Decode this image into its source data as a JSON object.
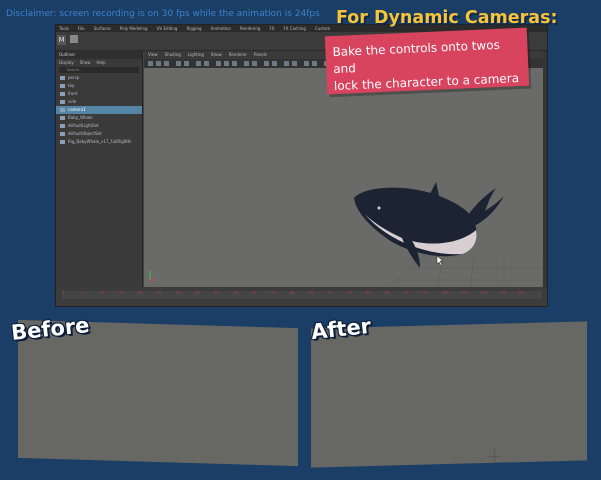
{
  "disclaimer": "Disclaimer: screen recording is on 30 fps while the animation is 24fps",
  "callout": {
    "title": "For Dynamic Cameras:",
    "body": "Bake the controls onto twos and\nlock the character to a camera"
  },
  "labels": {
    "before": "Before",
    "after": "After"
  },
  "maya": {
    "menubar": [
      "Tools",
      "File",
      "Surfaces",
      "Poly Modeling",
      "UV Editing",
      "Rigging",
      "Animation",
      "Rendering",
      "FX",
      "FX Caching",
      "Custom"
    ],
    "outliner": {
      "title": "Outliner",
      "menu": [
        "Display",
        "Show",
        "Help"
      ],
      "search_placeholder": "Search...",
      "items": [
        "persp",
        "top",
        "front",
        "side",
        "camera1",
        "Baby_Whale",
        "defaultLightSet",
        "defaultObjectSet",
        "Rig_BabyWhale_v17_FullRigWhi"
      ]
    },
    "viewport_menu": [
      "View",
      "Shading",
      "Lighting",
      "Show",
      "Renderer",
      "Panels"
    ],
    "timeline_ticks": [
      "0",
      "5",
      "10",
      "15",
      "20",
      "25",
      "30",
      "35",
      "40",
      "45",
      "50",
      "55",
      "60",
      "65",
      "70",
      "75",
      "80",
      "85",
      "90",
      "95",
      "100",
      "105",
      "110",
      "115",
      "120"
    ]
  },
  "colors": {
    "background": "#1b3e66",
    "callout_title": "#f6c33a",
    "callout_box": "#d8435d",
    "panel": "#676764"
  }
}
